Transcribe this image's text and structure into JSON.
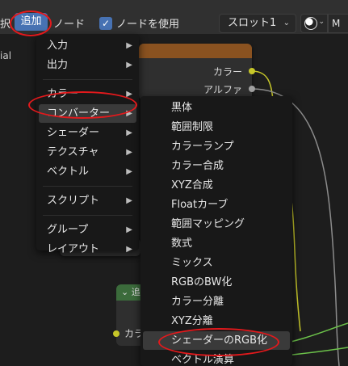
{
  "header": {
    "partial_left": "択",
    "add_label": "追加",
    "node_label": "ノード",
    "use_nodes_label": "ノードを使用",
    "use_nodes_checked": true,
    "slot_label": "スロット1",
    "slot_chevron": "⌄",
    "material_partial": "M"
  },
  "canvas": {
    "left_partial_text": "ial",
    "node_outputs": [
      "カラー",
      "アルファ"
    ],
    "green_node_partial": "追",
    "green_node_input_partial": "カラ"
  },
  "add_menu": {
    "groups": [
      [
        {
          "label": "入力",
          "submenu": true
        },
        {
          "label": "出力",
          "submenu": true
        }
      ],
      [
        {
          "label": "カラー",
          "submenu": true
        },
        {
          "label": "コンバーター",
          "submenu": true,
          "highlighted": true
        },
        {
          "label": "シェーダー",
          "submenu": true
        },
        {
          "label": "テクスチャ",
          "submenu": true
        },
        {
          "label": "ベクトル",
          "submenu": true
        }
      ],
      [
        {
          "label": "スクリプト",
          "submenu": true
        }
      ],
      [
        {
          "label": "グループ",
          "submenu": true
        },
        {
          "label": "レイアウト",
          "submenu": true
        }
      ]
    ]
  },
  "converter_menu": {
    "items": [
      "黒体",
      "範囲制限",
      "カラーランプ",
      "カラー合成",
      "XYZ合成",
      "Floatカーブ",
      "範囲マッピング",
      "数式",
      "ミックス",
      "RGBのBW化",
      "カラー分離",
      "XYZ分離",
      "シェーダーのRGB化",
      "ベクトル演算"
    ],
    "highlighted_index": 12
  },
  "colors": {
    "accent": "#4772b3",
    "annotation": "#e3191c",
    "node_header": "#8a5220",
    "socket_color": "#c7c729",
    "socket_float": "#a1a1a1",
    "wire_green": "#6cc24a"
  }
}
